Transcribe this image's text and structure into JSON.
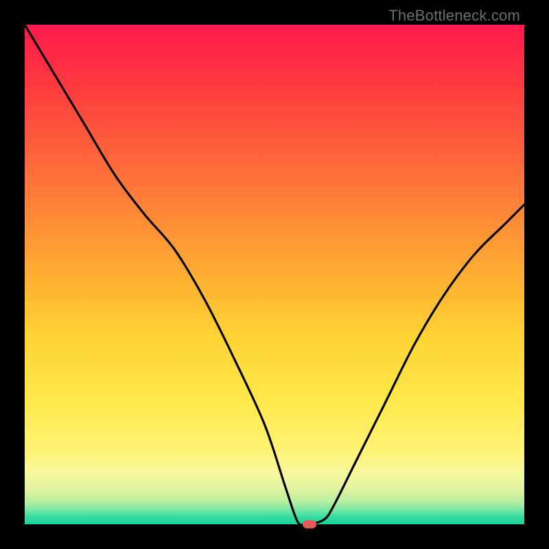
{
  "watermark": "TheBottleneck.com",
  "chart_data": {
    "type": "line",
    "title": "",
    "xlabel": "",
    "ylabel": "",
    "xlim": [
      0,
      100
    ],
    "ylim": [
      0,
      100
    ],
    "gradient_stops": [
      {
        "pct": 0,
        "color": "#ff1a4d"
      },
      {
        "pct": 12,
        "color": "#ff3a3f"
      },
      {
        "pct": 30,
        "color": "#ff6f3a"
      },
      {
        "pct": 48,
        "color": "#ffa733"
      },
      {
        "pct": 62,
        "color": "#ffd233"
      },
      {
        "pct": 75,
        "color": "#ffe84a"
      },
      {
        "pct": 85,
        "color": "#fff373"
      },
      {
        "pct": 90,
        "color": "#f7f9a0"
      },
      {
        "pct": 93,
        "color": "#dff2a0"
      },
      {
        "pct": 95.5,
        "color": "#b6f0a0"
      },
      {
        "pct": 97,
        "color": "#7de8a4"
      },
      {
        "pct": 98.5,
        "color": "#36dca0"
      },
      {
        "pct": 100,
        "color": "#17d39a"
      }
    ],
    "series": [
      {
        "name": "curve",
        "x": [
          0,
          6,
          12,
          18,
          24,
          30,
          36,
          42,
          48,
          52,
          54,
          55,
          56,
          57,
          60,
          62,
          66,
          72,
          78,
          84,
          90,
          96,
          100
        ],
        "y": [
          100,
          90,
          80,
          70,
          62,
          55,
          45,
          33,
          20,
          8,
          2,
          0,
          0,
          0,
          1,
          4,
          12,
          24,
          36,
          46,
          54,
          60,
          64
        ]
      }
    ],
    "marker": {
      "x": 57,
      "y": 0,
      "color": "#e55a5a"
    }
  }
}
